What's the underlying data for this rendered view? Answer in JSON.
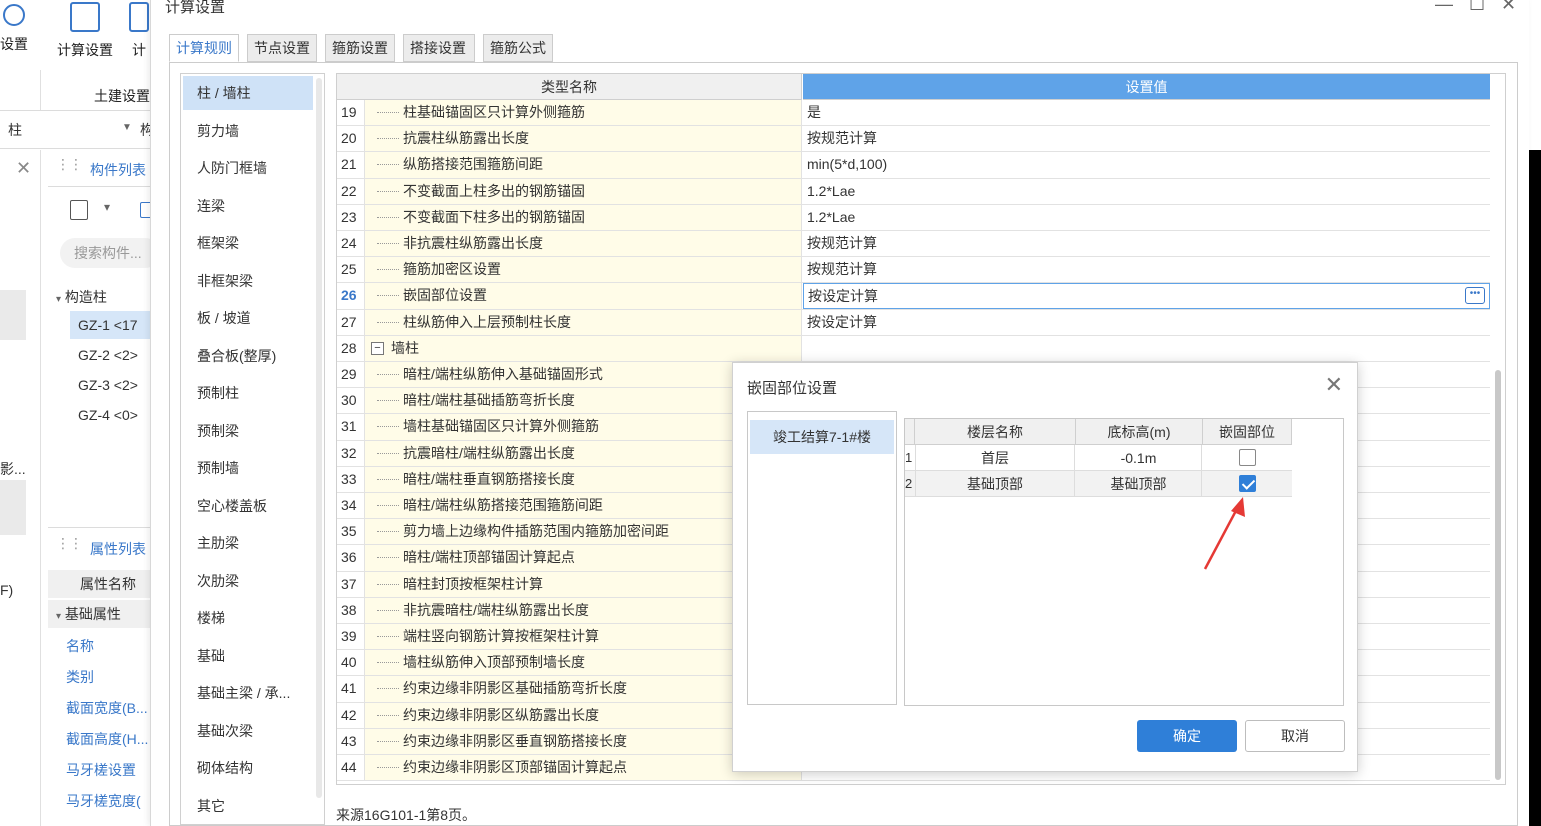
{
  "background_app": {
    "ribbon": [
      {
        "label": "设置",
        "icon": "settings-icon"
      },
      {
        "label": "计算设置",
        "icon": "calc-settings-icon"
      },
      {
        "label": "计",
        "icon": "calc-icon"
      }
    ],
    "ribbon_group": "土建设置",
    "floor_select": "柱",
    "floor_next": "构",
    "component_list_title": "构件列表",
    "search_placeholder": "搜索构件...",
    "tree_root": "构造柱",
    "tree_items": [
      "GZ-1 <17",
      "GZ-2 <2>",
      "GZ-3 <2>",
      "GZ-4 <0>"
    ],
    "side_text_1": "影...",
    "side_text_2": "F)",
    "property_list_title": "属性列表",
    "property_header": "属性名称",
    "property_group": "基础属性",
    "properties": [
      "名称",
      "类别",
      "截面宽度(B...",
      "截面高度(H...",
      "马牙槎设置",
      "马牙槎宽度("
    ]
  },
  "dialog": {
    "title": "计算设置",
    "controls": {
      "minimize": "—",
      "maximize": "☐",
      "close": "✕"
    },
    "tabs": [
      "计算规则",
      "节点设置",
      "箍筋设置",
      "搭接设置",
      "箍筋公式"
    ],
    "active_tab": 0,
    "categories": [
      "柱 / 墙柱",
      "剪力墙",
      "人防门框墙",
      "连梁",
      "框架梁",
      "非框架梁",
      "板 / 坡道",
      "叠合板(整厚)",
      "预制柱",
      "预制梁",
      "预制墙",
      "空心楼盖板",
      "主肋梁",
      "次肋梁",
      "楼梯",
      "基础",
      "基础主梁 / 承...",
      "基础次梁",
      "砌体结构",
      "其它"
    ],
    "selected_category": 0,
    "table": {
      "col_name": "类型名称",
      "col_value": "设置值",
      "rows": [
        {
          "num": "19",
          "name": "柱基础锚固区只计算外侧箍筋",
          "value": "是"
        },
        {
          "num": "20",
          "name": "抗震柱纵筋露出长度",
          "value": "按规范计算"
        },
        {
          "num": "21",
          "name": "纵筋搭接范围箍筋间距",
          "value": "min(5*d,100)"
        },
        {
          "num": "22",
          "name": "不变截面上柱多出的钢筋锚固",
          "value": "1.2*Lae"
        },
        {
          "num": "23",
          "name": "不变截面下柱多出的钢筋锚固",
          "value": "1.2*Lae"
        },
        {
          "num": "24",
          "name": "非抗震柱纵筋露出长度",
          "value": "按规范计算"
        },
        {
          "num": "25",
          "name": "箍筋加密区设置",
          "value": "按规范计算"
        },
        {
          "num": "26",
          "name": "嵌固部位设置",
          "value": "按设定计算"
        },
        {
          "num": "27",
          "name": "柱纵筋伸入上层预制柱长度",
          "value": "按设定计算"
        },
        {
          "num": "28",
          "name": "墙柱",
          "value": ""
        },
        {
          "num": "29",
          "name": "暗柱/端柱纵筋伸入基础锚固形式",
          "value": ""
        },
        {
          "num": "30",
          "name": "暗柱/端柱基础插筋弯折长度",
          "value": ""
        },
        {
          "num": "31",
          "name": "墙柱基础锚固区只计算外侧箍筋",
          "value": ""
        },
        {
          "num": "32",
          "name": "抗震暗柱/端柱纵筋露出长度",
          "value": ""
        },
        {
          "num": "33",
          "name": "暗柱/端柱垂直钢筋搭接长度",
          "value": ""
        },
        {
          "num": "34",
          "name": "暗柱/端柱纵筋搭接范围箍筋间距",
          "value": ""
        },
        {
          "num": "35",
          "name": "剪力墙上边缘构件插筋范围内箍筋加密间距",
          "value": ""
        },
        {
          "num": "36",
          "name": "暗柱/端柱顶部锚固计算起点",
          "value": ""
        },
        {
          "num": "37",
          "name": "暗柱封顶按框架柱计算",
          "value": ""
        },
        {
          "num": "38",
          "name": "非抗震暗柱/端柱纵筋露出长度",
          "value": ""
        },
        {
          "num": "39",
          "name": "端柱竖向钢筋计算按框架柱计算",
          "value": ""
        },
        {
          "num": "40",
          "name": "墙柱纵筋伸入顶部预制墙长度",
          "value": ""
        },
        {
          "num": "41",
          "name": "约束边缘非阴影区基础插筋弯折长度",
          "value": ""
        },
        {
          "num": "42",
          "name": "约束边缘非阴影区纵筋露出长度",
          "value": ""
        },
        {
          "num": "43",
          "name": "约束边缘非阴影区垂直钢筋搭接长度",
          "value": ""
        },
        {
          "num": "44",
          "name": "约束边缘非阴影区顶部锚固计算起点",
          "value": ""
        }
      ]
    },
    "source_note": "来源16G101-1第8页。"
  },
  "modal": {
    "title": "嵌固部位设置",
    "project": "竣工结算7-1#楼",
    "columns": [
      "楼层名称",
      "底标高(m)",
      "嵌固部位"
    ],
    "floors": [
      {
        "num": "1",
        "name": "首层",
        "elevation": "-0.1m",
        "embedded": false
      },
      {
        "num": "2",
        "name": "基础顶部",
        "elevation": "基础顶部",
        "embedded": true
      }
    ],
    "ok": "确定",
    "cancel": "取消"
  },
  "colors": {
    "accent": "#2f7fd8",
    "header_blue": "#5fa3e8",
    "name_bg": "#fffce8",
    "arrow": "#e53935"
  }
}
